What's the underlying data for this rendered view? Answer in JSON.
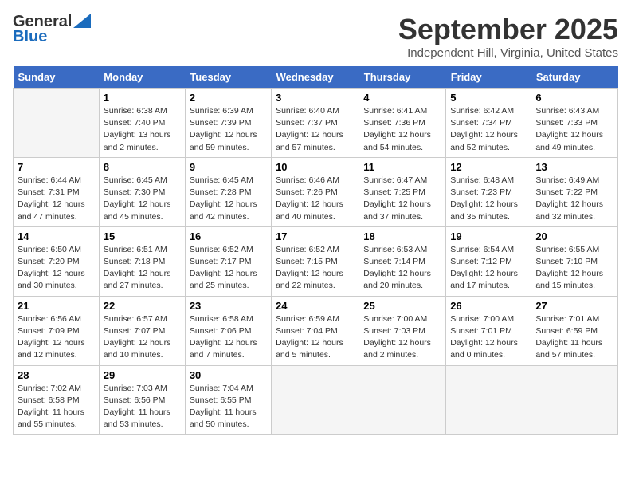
{
  "logo": {
    "general": "General",
    "blue": "Blue"
  },
  "header": {
    "month": "September 2025",
    "location": "Independent Hill, Virginia, United States"
  },
  "columns": [
    "Sunday",
    "Monday",
    "Tuesday",
    "Wednesday",
    "Thursday",
    "Friday",
    "Saturday"
  ],
  "weeks": [
    [
      {
        "day": "",
        "sunrise": "",
        "sunset": "",
        "daylight": ""
      },
      {
        "day": "1",
        "sunrise": "Sunrise: 6:38 AM",
        "sunset": "Sunset: 7:40 PM",
        "daylight": "Daylight: 13 hours and 2 minutes."
      },
      {
        "day": "2",
        "sunrise": "Sunrise: 6:39 AM",
        "sunset": "Sunset: 7:39 PM",
        "daylight": "Daylight: 12 hours and 59 minutes."
      },
      {
        "day": "3",
        "sunrise": "Sunrise: 6:40 AM",
        "sunset": "Sunset: 7:37 PM",
        "daylight": "Daylight: 12 hours and 57 minutes."
      },
      {
        "day": "4",
        "sunrise": "Sunrise: 6:41 AM",
        "sunset": "Sunset: 7:36 PM",
        "daylight": "Daylight: 12 hours and 54 minutes."
      },
      {
        "day": "5",
        "sunrise": "Sunrise: 6:42 AM",
        "sunset": "Sunset: 7:34 PM",
        "daylight": "Daylight: 12 hours and 52 minutes."
      },
      {
        "day": "6",
        "sunrise": "Sunrise: 6:43 AM",
        "sunset": "Sunset: 7:33 PM",
        "daylight": "Daylight: 12 hours and 49 minutes."
      }
    ],
    [
      {
        "day": "7",
        "sunrise": "Sunrise: 6:44 AM",
        "sunset": "Sunset: 7:31 PM",
        "daylight": "Daylight: 12 hours and 47 minutes."
      },
      {
        "day": "8",
        "sunrise": "Sunrise: 6:45 AM",
        "sunset": "Sunset: 7:30 PM",
        "daylight": "Daylight: 12 hours and 45 minutes."
      },
      {
        "day": "9",
        "sunrise": "Sunrise: 6:45 AM",
        "sunset": "Sunset: 7:28 PM",
        "daylight": "Daylight: 12 hours and 42 minutes."
      },
      {
        "day": "10",
        "sunrise": "Sunrise: 6:46 AM",
        "sunset": "Sunset: 7:26 PM",
        "daylight": "Daylight: 12 hours and 40 minutes."
      },
      {
        "day": "11",
        "sunrise": "Sunrise: 6:47 AM",
        "sunset": "Sunset: 7:25 PM",
        "daylight": "Daylight: 12 hours and 37 minutes."
      },
      {
        "day": "12",
        "sunrise": "Sunrise: 6:48 AM",
        "sunset": "Sunset: 7:23 PM",
        "daylight": "Daylight: 12 hours and 35 minutes."
      },
      {
        "day": "13",
        "sunrise": "Sunrise: 6:49 AM",
        "sunset": "Sunset: 7:22 PM",
        "daylight": "Daylight: 12 hours and 32 minutes."
      }
    ],
    [
      {
        "day": "14",
        "sunrise": "Sunrise: 6:50 AM",
        "sunset": "Sunset: 7:20 PM",
        "daylight": "Daylight: 12 hours and 30 minutes."
      },
      {
        "day": "15",
        "sunrise": "Sunrise: 6:51 AM",
        "sunset": "Sunset: 7:18 PM",
        "daylight": "Daylight: 12 hours and 27 minutes."
      },
      {
        "day": "16",
        "sunrise": "Sunrise: 6:52 AM",
        "sunset": "Sunset: 7:17 PM",
        "daylight": "Daylight: 12 hours and 25 minutes."
      },
      {
        "day": "17",
        "sunrise": "Sunrise: 6:52 AM",
        "sunset": "Sunset: 7:15 PM",
        "daylight": "Daylight: 12 hours and 22 minutes."
      },
      {
        "day": "18",
        "sunrise": "Sunrise: 6:53 AM",
        "sunset": "Sunset: 7:14 PM",
        "daylight": "Daylight: 12 hours and 20 minutes."
      },
      {
        "day": "19",
        "sunrise": "Sunrise: 6:54 AM",
        "sunset": "Sunset: 7:12 PM",
        "daylight": "Daylight: 12 hours and 17 minutes."
      },
      {
        "day": "20",
        "sunrise": "Sunrise: 6:55 AM",
        "sunset": "Sunset: 7:10 PM",
        "daylight": "Daylight: 12 hours and 15 minutes."
      }
    ],
    [
      {
        "day": "21",
        "sunrise": "Sunrise: 6:56 AM",
        "sunset": "Sunset: 7:09 PM",
        "daylight": "Daylight: 12 hours and 12 minutes."
      },
      {
        "day": "22",
        "sunrise": "Sunrise: 6:57 AM",
        "sunset": "Sunset: 7:07 PM",
        "daylight": "Daylight: 12 hours and 10 minutes."
      },
      {
        "day": "23",
        "sunrise": "Sunrise: 6:58 AM",
        "sunset": "Sunset: 7:06 PM",
        "daylight": "Daylight: 12 hours and 7 minutes."
      },
      {
        "day": "24",
        "sunrise": "Sunrise: 6:59 AM",
        "sunset": "Sunset: 7:04 PM",
        "daylight": "Daylight: 12 hours and 5 minutes."
      },
      {
        "day": "25",
        "sunrise": "Sunrise: 7:00 AM",
        "sunset": "Sunset: 7:03 PM",
        "daylight": "Daylight: 12 hours and 2 minutes."
      },
      {
        "day": "26",
        "sunrise": "Sunrise: 7:00 AM",
        "sunset": "Sunset: 7:01 PM",
        "daylight": "Daylight: 12 hours and 0 minutes."
      },
      {
        "day": "27",
        "sunrise": "Sunrise: 7:01 AM",
        "sunset": "Sunset: 6:59 PM",
        "daylight": "Daylight: 11 hours and 57 minutes."
      }
    ],
    [
      {
        "day": "28",
        "sunrise": "Sunrise: 7:02 AM",
        "sunset": "Sunset: 6:58 PM",
        "daylight": "Daylight: 11 hours and 55 minutes."
      },
      {
        "day": "29",
        "sunrise": "Sunrise: 7:03 AM",
        "sunset": "Sunset: 6:56 PM",
        "daylight": "Daylight: 11 hours and 53 minutes."
      },
      {
        "day": "30",
        "sunrise": "Sunrise: 7:04 AM",
        "sunset": "Sunset: 6:55 PM",
        "daylight": "Daylight: 11 hours and 50 minutes."
      },
      {
        "day": "",
        "sunrise": "",
        "sunset": "",
        "daylight": ""
      },
      {
        "day": "",
        "sunrise": "",
        "sunset": "",
        "daylight": ""
      },
      {
        "day": "",
        "sunrise": "",
        "sunset": "",
        "daylight": ""
      },
      {
        "day": "",
        "sunrise": "",
        "sunset": "",
        "daylight": ""
      }
    ]
  ]
}
